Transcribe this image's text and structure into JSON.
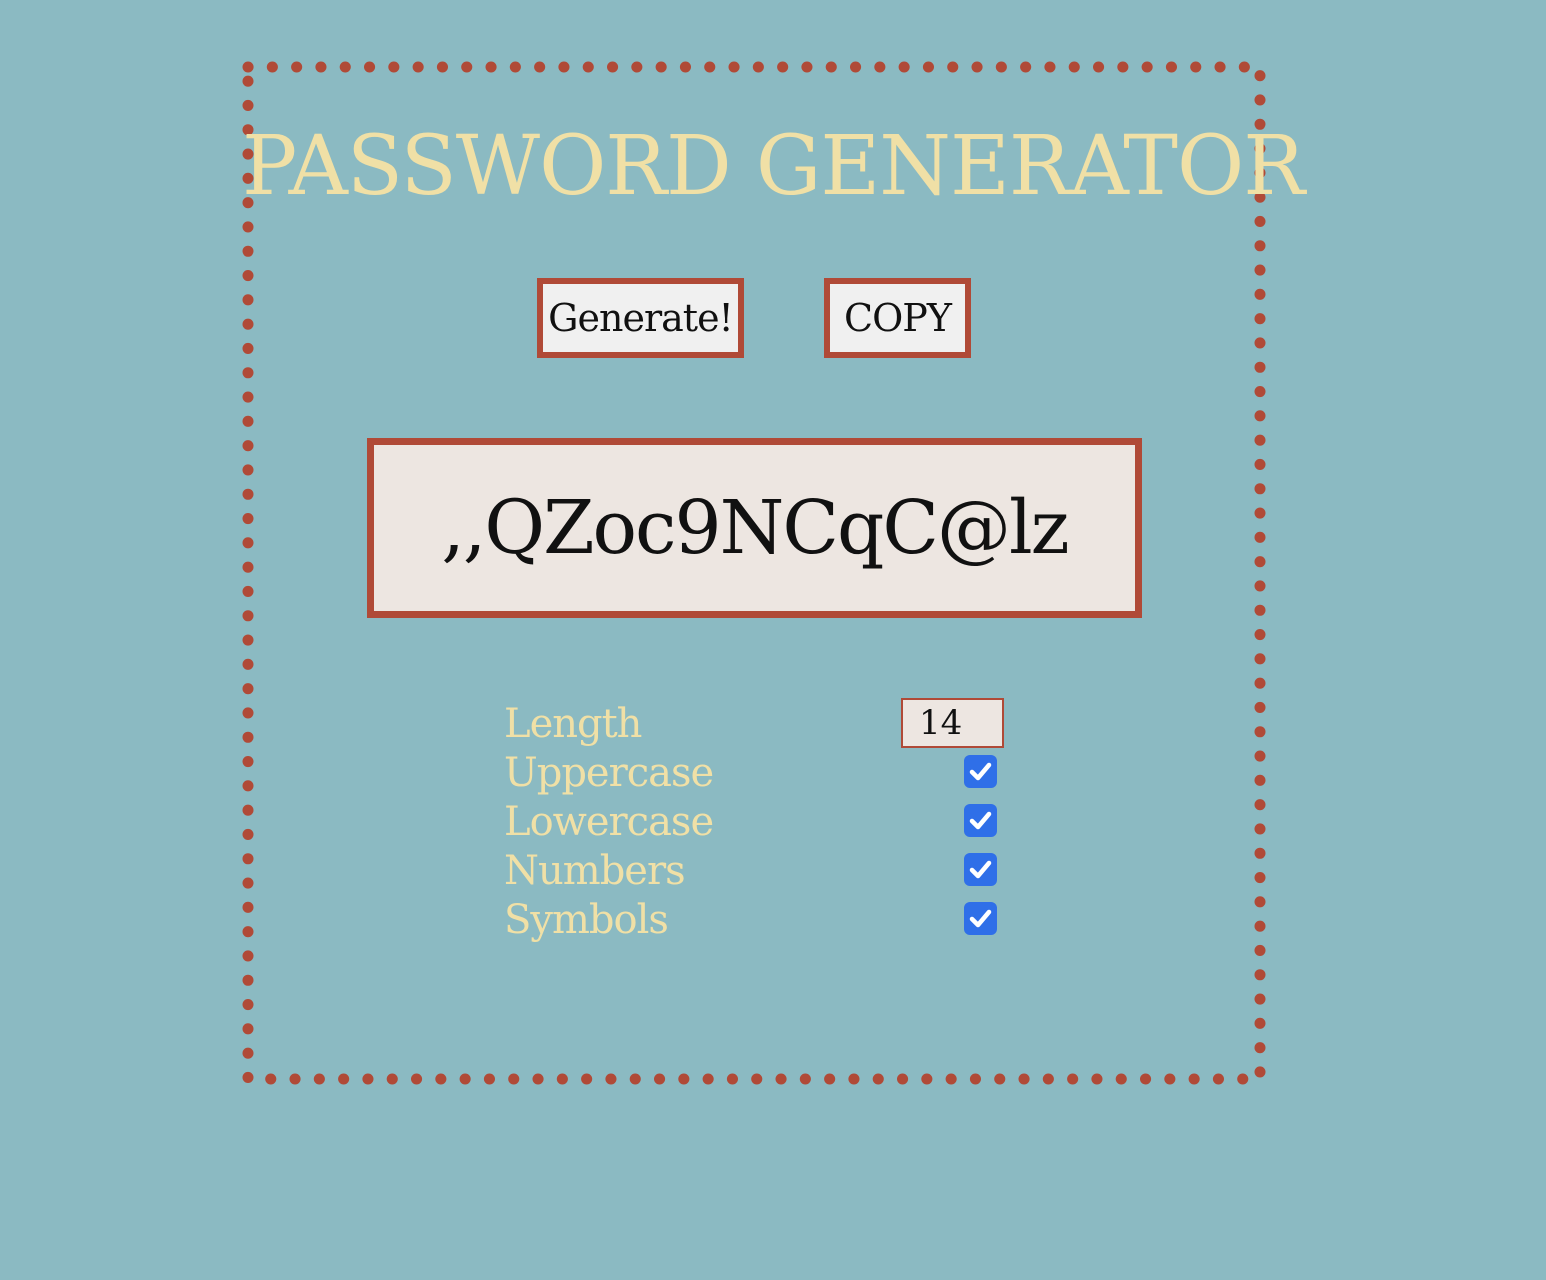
{
  "app": {
    "title": "PASSWORD GENERATOR"
  },
  "actions": {
    "generate_label": "Generate!",
    "copy_label": "COPY"
  },
  "output": {
    "password": ",,QZoc9NCqC@lz"
  },
  "options": {
    "length_label": "Length",
    "length_value": "14",
    "uppercase_label": "Uppercase",
    "uppercase_checked": true,
    "lowercase_label": "Lowercase",
    "lowercase_checked": true,
    "numbers_label": "Numbers",
    "numbers_checked": true,
    "symbols_label": "Symbols",
    "symbols_checked": true
  },
  "colors": {
    "background": "#8bbac2",
    "accent": "#b04a37",
    "title_text": "#f0e0a6",
    "checkbox": "#2f6fe8"
  }
}
